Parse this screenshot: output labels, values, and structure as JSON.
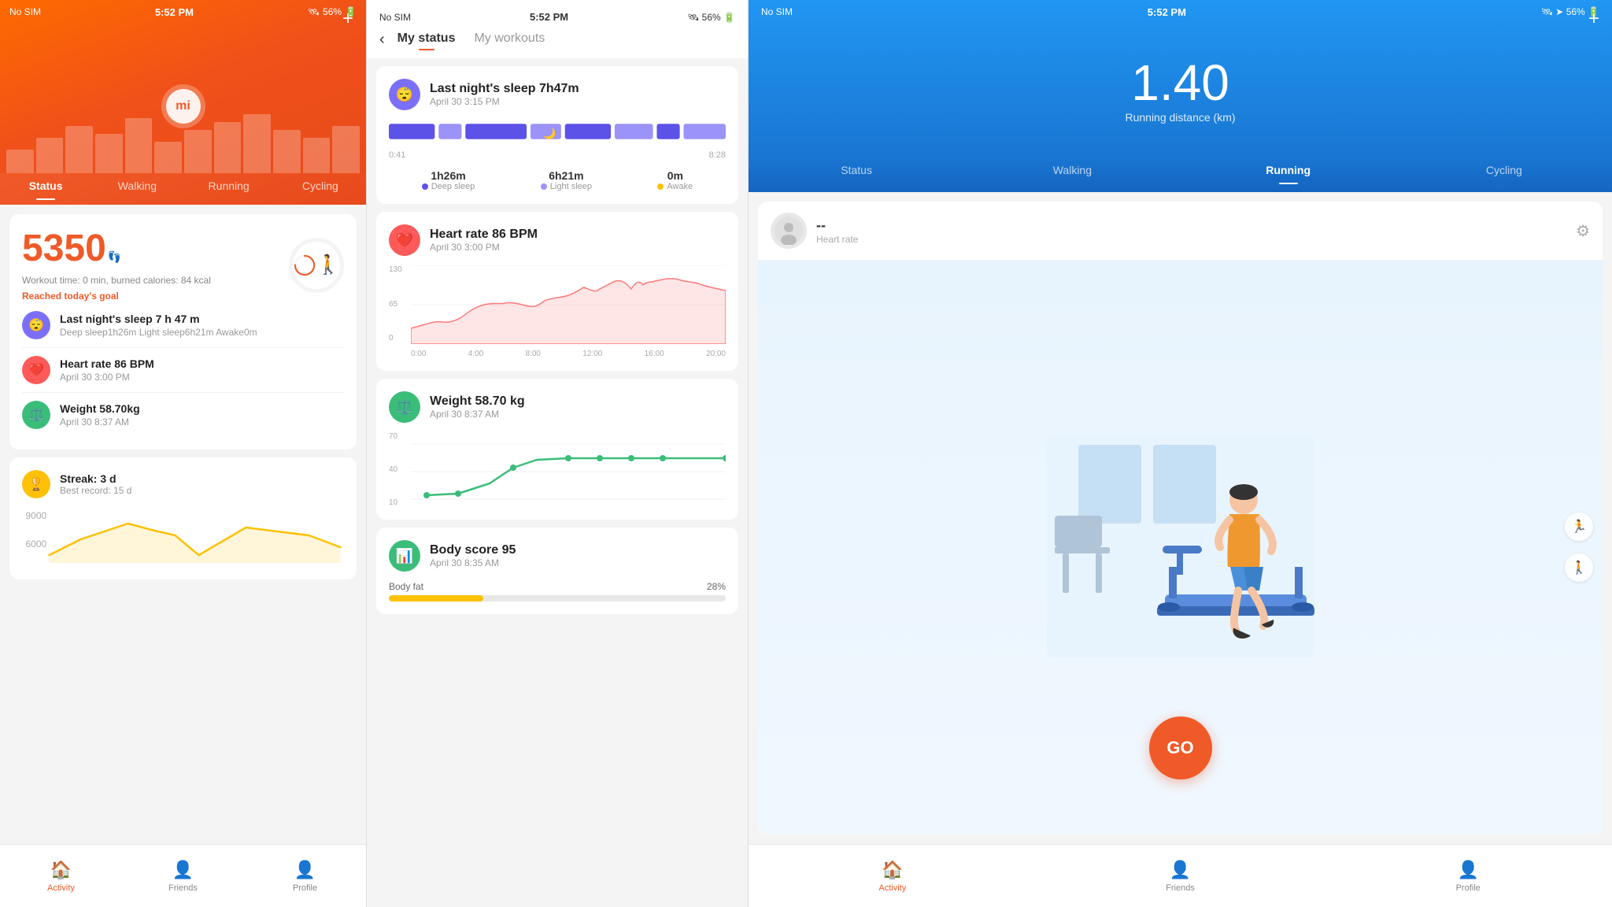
{
  "screen1": {
    "status_bar": {
      "left": "No SIM",
      "center": "5:52 PM",
      "battery": "56%"
    },
    "header": {
      "logo": "mi",
      "plus_label": "+"
    },
    "tabs": [
      "Status",
      "Walking",
      "Running",
      "Cycling"
    ],
    "active_tab": 0,
    "steps": {
      "count": "5350",
      "unit": "",
      "workout_info": "Workout time: 0 min, burned calories: 84 kcal",
      "goal_label": "Reached today's goal"
    },
    "activities": [
      {
        "icon": "sleep",
        "title": "Last night's sleep 7 h 47 m",
        "subtitle": "Deep sleep1h26m Light sleep6h21m Awake0m"
      },
      {
        "icon": "heart",
        "title": "Heart rate 86 BPM",
        "subtitle": "April 30 3:00 PM"
      },
      {
        "icon": "weight",
        "title": "Weight 58.70kg",
        "subtitle": "April 30 8:37 AM"
      }
    ],
    "streak": {
      "title": "Streak: 3 d",
      "subtitle": "Best record: 15 d",
      "y_labels": [
        "9000",
        "6000"
      ]
    },
    "bottom_nav": [
      {
        "label": "Activity",
        "active": true
      },
      {
        "label": "Friends",
        "active": false
      },
      {
        "label": "Profile",
        "active": false
      }
    ]
  },
  "screen2": {
    "status_bar": {
      "left": "No SIM",
      "center": "5:52 PM",
      "battery": "56%"
    },
    "tabs": [
      "My status",
      "My workouts"
    ],
    "active_tab": 0,
    "cards": {
      "sleep": {
        "title": "Last night's sleep 7h47m",
        "subtitle": "April 30 3:15 PM",
        "time_start": "0:41",
        "time_end": "8:28",
        "stats": [
          {
            "value": "1h26m",
            "label": "Deep sleep",
            "dot": "dark"
          },
          {
            "value": "6h21m",
            "label": "Light sleep",
            "dot": "light"
          },
          {
            "value": "0m",
            "label": "Awake",
            "dot": "awake"
          }
        ]
      },
      "heart_rate": {
        "title": "Heart rate 86 BPM",
        "subtitle": "April 30 3:00 PM",
        "y_labels": [
          "130",
          "65",
          "0"
        ],
        "x_labels": [
          "0:00",
          "4:00",
          "8:00",
          "12:00",
          "16:00",
          "20:00"
        ]
      },
      "weight": {
        "title": "Weight 58.70 kg",
        "subtitle": "April 30 8:37 AM",
        "y_labels": [
          "70",
          "40",
          "10"
        ]
      },
      "body_score": {
        "title": "Body score 95",
        "subtitle": "April 30 8:35 AM",
        "body_fat_label": "Body fat",
        "body_fat_value": "28%",
        "body_fat_pct": 28
      }
    }
  },
  "screen3": {
    "status_bar": {
      "left": "No SIM",
      "center": "5:52 PM",
      "battery": "56%"
    },
    "header": {
      "distance": "1.40",
      "distance_label": "Running distance (km)"
    },
    "tabs": [
      "Status",
      "Walking",
      "Running",
      "Cycling"
    ],
    "active_tab": 2,
    "heart_rate_panel": {
      "value": "--",
      "label": "Heart rate"
    },
    "go_button": "GO",
    "bottom_nav": [
      {
        "label": "Activity",
        "active": true
      },
      {
        "label": "Friends",
        "active": false
      },
      {
        "label": "Profile",
        "active": false
      }
    ]
  }
}
